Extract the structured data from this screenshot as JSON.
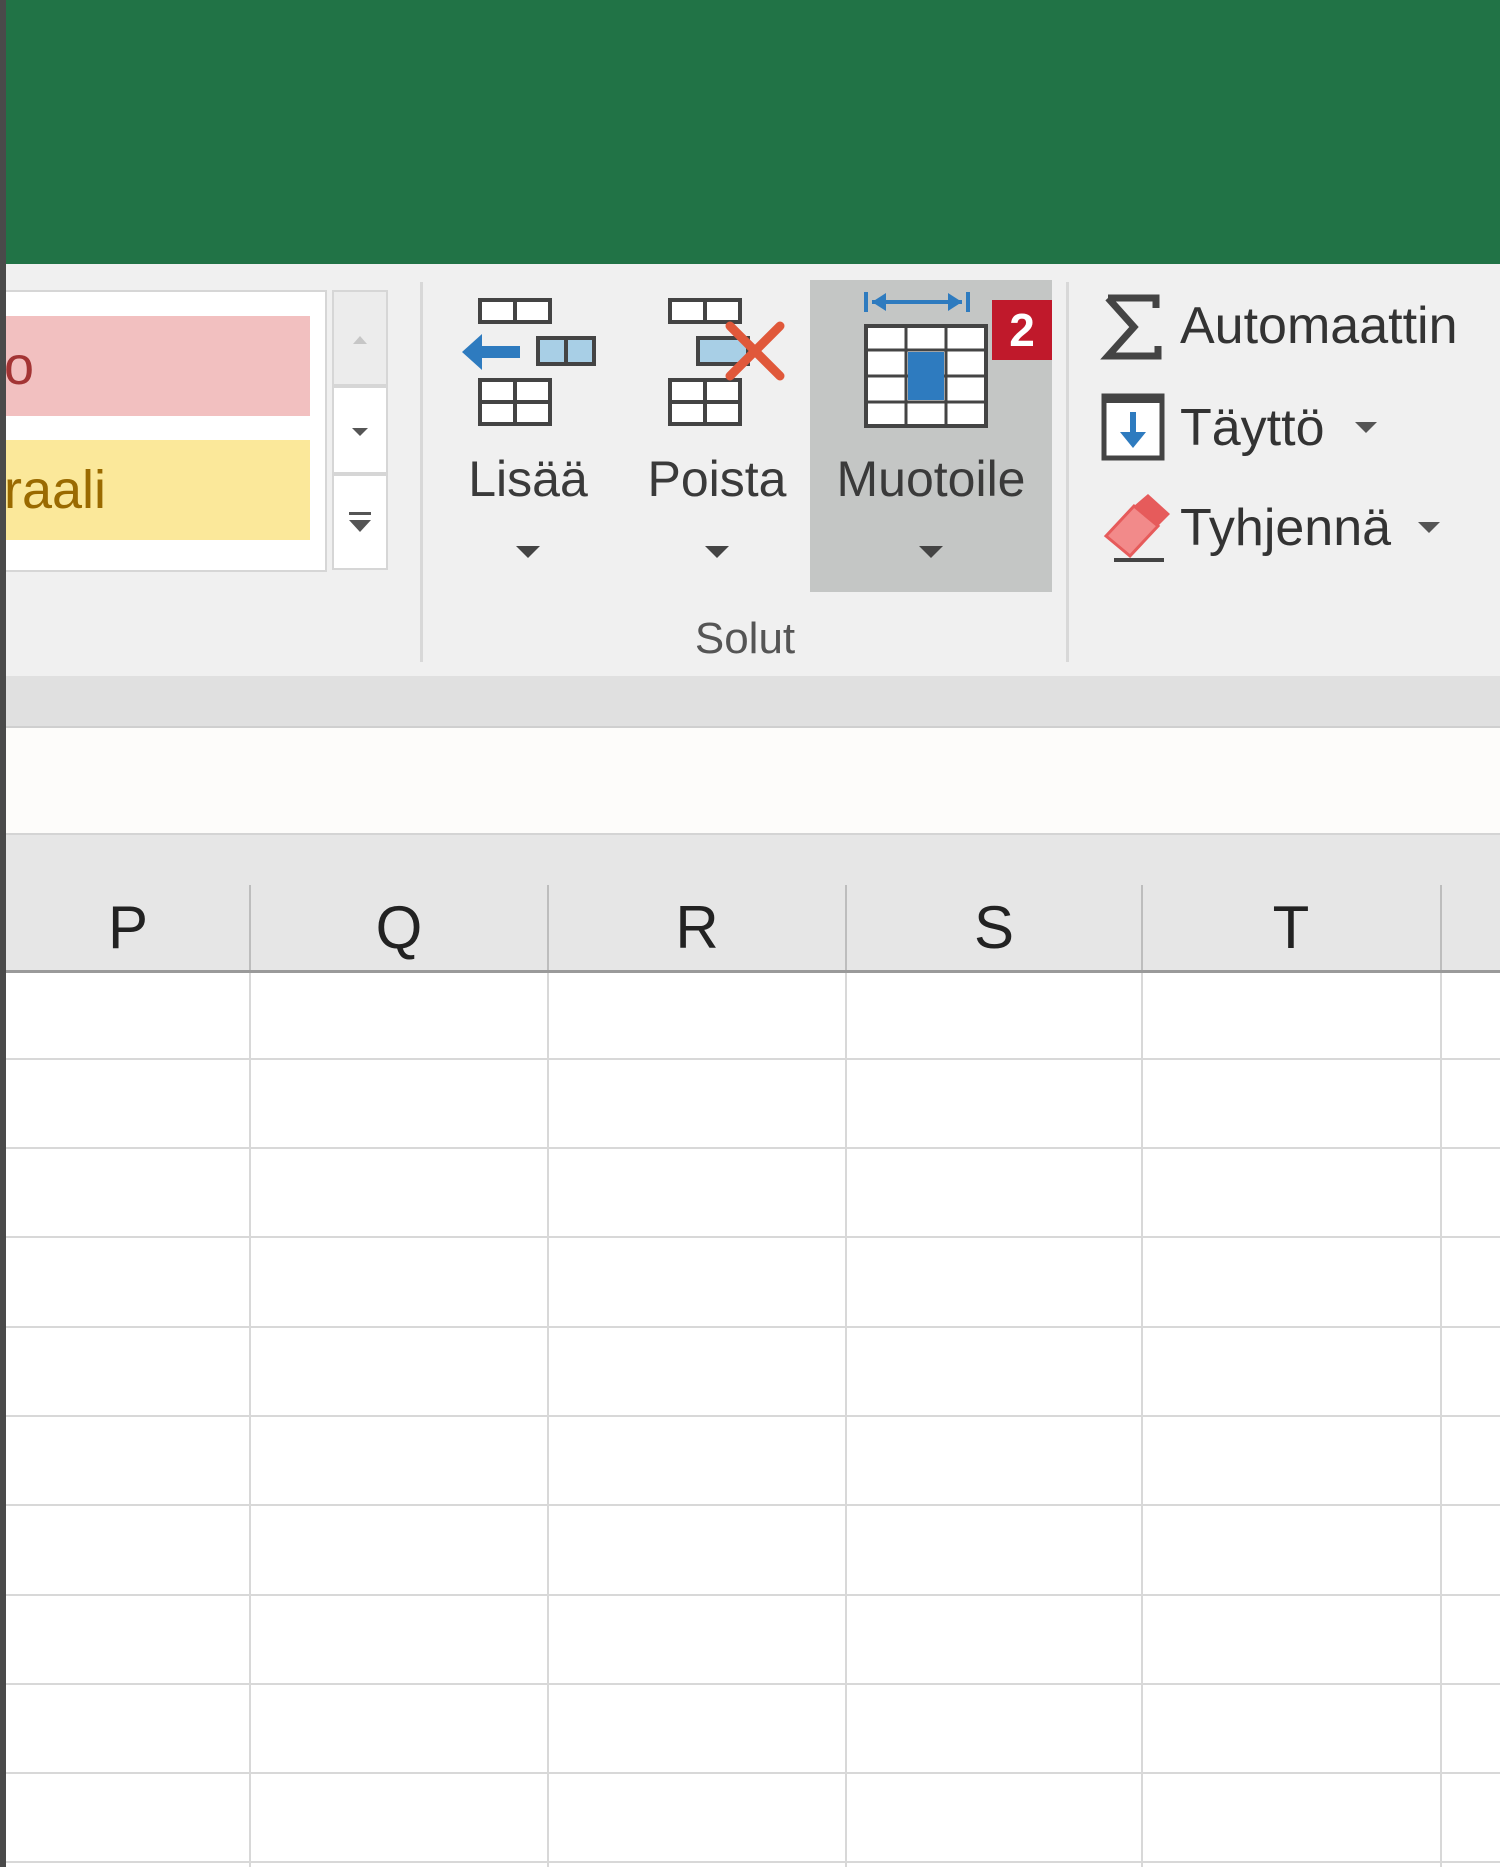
{
  "ribbon": {
    "styles_gallery": {
      "items": [
        {
          "label": "o",
          "fill": "#f2c0c0",
          "text_color": "#a33434"
        },
        {
          "label": "raali",
          "fill": "#fbe89a",
          "text_color": "#9a6a00"
        }
      ]
    },
    "cells_group": {
      "label": "Solut",
      "buttons": [
        {
          "label": "Lisää",
          "icon": "insert-cells-icon"
        },
        {
          "label": "Poista",
          "icon": "delete-cells-icon"
        },
        {
          "label": "Muotoile",
          "icon": "format-cells-icon",
          "highlighted": true,
          "badge": "2"
        }
      ]
    },
    "editing_group": {
      "items": [
        {
          "label": "Automaattin",
          "icon": "sigma-icon"
        },
        {
          "label": "Täyttö",
          "icon": "fill-down-icon"
        },
        {
          "label": "Tyhjennä",
          "icon": "eraser-icon"
        }
      ]
    }
  },
  "sheet": {
    "columns": [
      "P",
      "Q",
      "R",
      "S",
      "T"
    ]
  },
  "colors": {
    "title_bar": "#217346",
    "accent_blue": "#2e7bbf",
    "badge_red": "#c0192b",
    "delete_x": "#e0583a"
  }
}
